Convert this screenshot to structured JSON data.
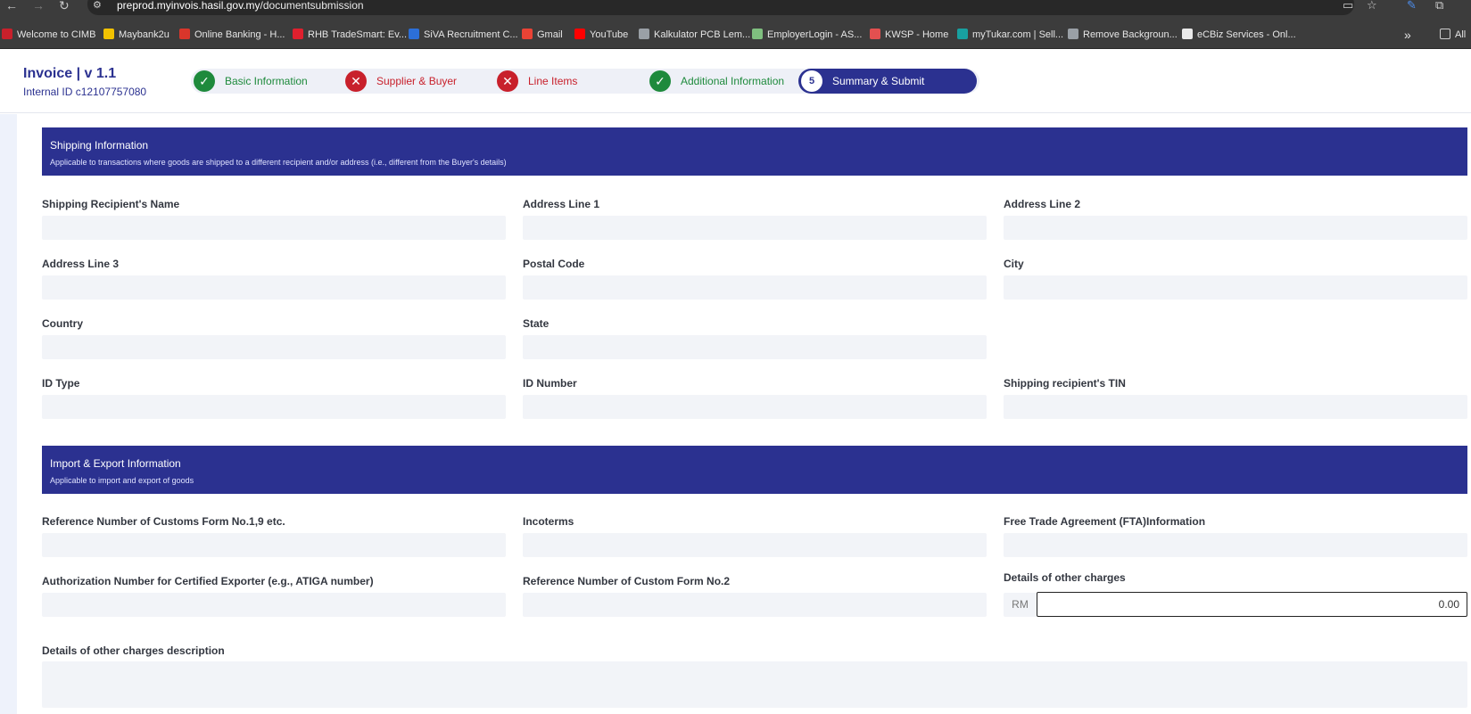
{
  "browser": {
    "url_host": "preprod.myinvois.hasil.gov.my",
    "url_path": "/documentsubmission",
    "bookmarks": [
      {
        "label": "Welcome to CIMB",
        "color": "#c8202b"
      },
      {
        "label": "Maybank2u",
        "color": "#f2c200"
      },
      {
        "label": "Online Banking - H...",
        "color": "#d9362b"
      },
      {
        "label": "RHB TradeSmart: Ev...",
        "color": "#e0202e"
      },
      {
        "label": "SiVA Recruitment C...",
        "color": "#2c6fd8"
      },
      {
        "label": "Gmail",
        "color": "#ea4335"
      },
      {
        "label": "YouTube",
        "color": "#ff0000"
      },
      {
        "label": "Kalkulator PCB Lem...",
        "color": "#9aa0a6"
      },
      {
        "label": "EmployerLogin - AS...",
        "color": "#7fbf7f"
      },
      {
        "label": "KWSP - Home",
        "color": "#e35050"
      },
      {
        "label": "myTukar.com | Sell...",
        "color": "#18a0a0"
      },
      {
        "label": "Remove Backgroun...",
        "color": "#9aa0a6"
      },
      {
        "label": "eCBiz Services - Onl...",
        "color": "#e9e9e9"
      }
    ],
    "overflow_label": "»",
    "all_bookmarks_label": "All"
  },
  "header": {
    "title": "Invoice | v 1.1",
    "internal_id": "Internal ID c12107757080",
    "steps": [
      {
        "label": "Basic Information",
        "status": "ok",
        "glyph": "✓"
      },
      {
        "label": "Supplier & Buyer",
        "status": "err",
        "glyph": "✕"
      },
      {
        "label": "Line Items",
        "status": "err",
        "glyph": "✕"
      },
      {
        "label": "Additional Information",
        "status": "ok",
        "glyph": "✓"
      },
      {
        "label": "Summary & Submit",
        "status": "active",
        "glyph": "5"
      }
    ]
  },
  "shipping": {
    "title": "Shipping Information",
    "description": "Applicable to transactions where goods are shipped to a different recipient and/or address (i.e., different from the Buyer's details)",
    "fields": {
      "recipient_name": "Shipping Recipient's Name",
      "address1": "Address Line 1",
      "address2": "Address Line 2",
      "address3": "Address Line 3",
      "postal_code": "Postal Code",
      "city": "City",
      "country": "Country",
      "state": "State",
      "id_type": "ID Type",
      "id_number": "ID Number",
      "tin": "Shipping recipient's TIN"
    }
  },
  "import_export": {
    "title": "Import & Export Information",
    "description": "Applicable to import and export of goods",
    "fields": {
      "customs_ref": "Reference Number of Customs Form No.1,9 etc.",
      "incoterms": "Incoterms",
      "fta": "Free Trade Agreement (FTA)Information",
      "auth_number": "Authorization Number for Certified Exporter (e.g., ATIGA number)",
      "customs_ref2": "Reference Number of Custom Form No.2",
      "other_charges": "Details of other charges",
      "other_charges_currency": "RM",
      "other_charges_value": "0.00",
      "other_charges_desc": "Details of other charges description"
    }
  }
}
